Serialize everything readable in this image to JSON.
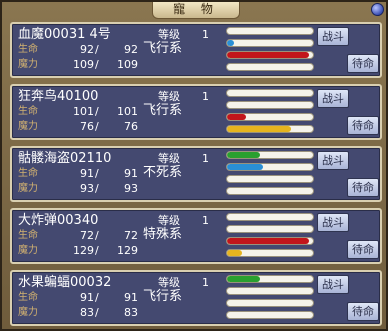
{
  "window": {
    "title": "寵 物"
  },
  "labels": {
    "level": "等级",
    "hp": "生命",
    "mp": "魔力",
    "sep": "/"
  },
  "colors": {
    "hp": "#c2161b",
    "mp": "#e6b41e",
    "exp": "#2aa02f",
    "loyalty": "#2a8fd6"
  },
  "pets": [
    {
      "name": "血魔00031 4号",
      "level": "1",
      "hp_cur": "92",
      "hp_max": "92",
      "mp_cur": "109",
      "mp_max": "109",
      "element": "飞行系",
      "bars": [
        0.0,
        0.08,
        0.95,
        0.0
      ],
      "fight_label": "战斗",
      "standby_label": "待命"
    },
    {
      "name": "狂奔鸟40100",
      "level": "1",
      "hp_cur": "101",
      "hp_max": "101",
      "mp_cur": "76",
      "mp_max": "76",
      "element": "飞行系",
      "bars": [
        0.0,
        0.0,
        0.22,
        0.74
      ],
      "fight_label": "战斗",
      "standby_label": "待命"
    },
    {
      "name": "骷髅海盗02110",
      "level": "1",
      "hp_cur": "91",
      "hp_max": "91",
      "mp_cur": "93",
      "mp_max": "93",
      "element": "不死系",
      "bars": [
        0.38,
        0.42,
        0.0,
        0.0
      ],
      "fight_label": "战斗",
      "standby_label": "待命"
    },
    {
      "name": "大炸弹00340",
      "level": "1",
      "hp_cur": "72",
      "hp_max": "72",
      "mp_cur": "129",
      "mp_max": "129",
      "element": "特殊系",
      "bars": [
        0.0,
        0.0,
        0.95,
        0.18
      ],
      "fight_label": "战斗",
      "standby_label": "待命"
    },
    {
      "name": "水果蝙蝠00032",
      "level": "1",
      "hp_cur": "91",
      "hp_max": "91",
      "mp_cur": "83",
      "mp_max": "83",
      "element": "飞行系",
      "bars": [
        0.38,
        0.0,
        0.0,
        0.0
      ],
      "fight_label": "战斗",
      "standby_label": "待命"
    }
  ]
}
